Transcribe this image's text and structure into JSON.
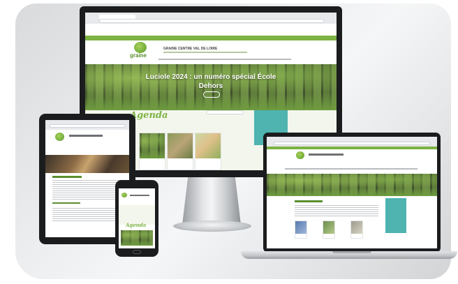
{
  "monitor": {
    "site_name": "GRAINE CENTRE VAL DE LOIRE",
    "hero_title_line1": "Luciole 2024 : un numéro spécial École",
    "hero_title_line2": "Dehors",
    "agenda_heading": "Agenda"
  },
  "colors": {
    "brand_green": "#7cb342",
    "teal": "#4fb3b0",
    "device_black": "#1b1c1e"
  },
  "icons": [
    "graine-logo-icon"
  ]
}
